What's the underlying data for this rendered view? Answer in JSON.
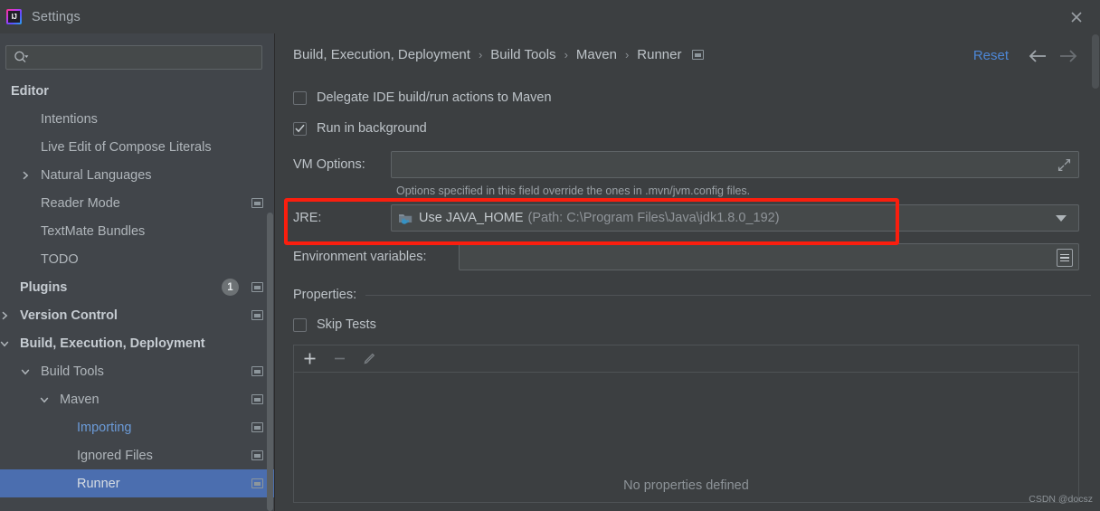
{
  "window": {
    "title": "Settings",
    "app_icon": "intellij-idea-icon",
    "close_icon": "close-icon"
  },
  "sidebar": {
    "search": {
      "placeholder": "",
      "value": "",
      "icon": "search-icon"
    },
    "items": [
      {
        "label": "Editor",
        "indent": 12,
        "bold": true,
        "arrow": "",
        "badge": "",
        "modified": false,
        "selected": false,
        "link": false
      },
      {
        "label": "Intentions",
        "indent": 45,
        "bold": false,
        "arrow": "",
        "badge": "",
        "modified": false,
        "selected": false,
        "link": false
      },
      {
        "label": "Live Edit of Compose Literals",
        "indent": 45,
        "bold": false,
        "arrow": "",
        "badge": "",
        "modified": false,
        "selected": false,
        "link": false
      },
      {
        "label": "Natural Languages",
        "indent": 45,
        "bold": false,
        "arrow": "right",
        "badge": "",
        "modified": false,
        "selected": false,
        "link": false
      },
      {
        "label": "Reader Mode",
        "indent": 45,
        "bold": false,
        "arrow": "",
        "badge": "",
        "modified": true,
        "selected": false,
        "link": false
      },
      {
        "label": "TextMate Bundles",
        "indent": 45,
        "bold": false,
        "arrow": "",
        "badge": "",
        "modified": false,
        "selected": false,
        "link": false
      },
      {
        "label": "TODO",
        "indent": 45,
        "bold": false,
        "arrow": "",
        "badge": "",
        "modified": false,
        "selected": false,
        "link": false
      },
      {
        "label": "Plugins",
        "indent": 22,
        "bold": true,
        "arrow": "",
        "badge": "1",
        "modified": true,
        "selected": false,
        "link": false
      },
      {
        "label": "Version Control",
        "indent": 22,
        "bold": true,
        "arrow": "right",
        "badge": "",
        "modified": true,
        "selected": false,
        "link": false
      },
      {
        "label": "Build, Execution, Deployment",
        "indent": 22,
        "bold": true,
        "arrow": "down",
        "badge": "",
        "modified": false,
        "selected": false,
        "link": false
      },
      {
        "label": "Build Tools",
        "indent": 45,
        "bold": false,
        "arrow": "down",
        "badge": "",
        "modified": true,
        "selected": false,
        "link": false
      },
      {
        "label": "Maven",
        "indent": 66,
        "bold": false,
        "arrow": "down",
        "badge": "",
        "modified": true,
        "selected": false,
        "link": false
      },
      {
        "label": "Importing",
        "indent": 85,
        "bold": false,
        "arrow": "",
        "badge": "",
        "modified": true,
        "selected": false,
        "link": true
      },
      {
        "label": "Ignored Files",
        "indent": 85,
        "bold": false,
        "arrow": "",
        "badge": "",
        "modified": true,
        "selected": false,
        "link": false
      },
      {
        "label": "Runner",
        "indent": 85,
        "bold": false,
        "arrow": "",
        "badge": "",
        "modified": true,
        "selected": true,
        "link": false
      }
    ]
  },
  "header": {
    "breadcrumb": [
      "Build, Execution, Deployment",
      "Build Tools",
      "Maven",
      "Runner"
    ],
    "separator": "›",
    "modified_icon": "modified-settings-icon",
    "reset_label": "Reset",
    "back_icon": "arrow-left-icon",
    "forward_icon": "arrow-right-icon"
  },
  "form": {
    "delegate": {
      "label": "Delegate IDE build/run actions to Maven",
      "checked": false
    },
    "run_background": {
      "label": "Run in background",
      "checked": true
    },
    "vm_options": {
      "label": "VM Options:",
      "value": "",
      "expand_icon": "expand-icon"
    },
    "vm_hint": "Options specified in this field override the ones in .mvn/jvm.config files.",
    "jre": {
      "label": "JRE:",
      "icon": "java-home-folder-icon",
      "value_main": "Use JAVA_HOME",
      "value_path": "(Path: C:\\Program Files\\Java\\jdk1.8.0_192)",
      "caret_icon": "chevron-down-icon"
    },
    "env_vars": {
      "label": "Environment variables:",
      "value": "",
      "browse_icon": "browse-icon"
    },
    "properties_section": "Properties:",
    "skip_tests": {
      "label": "Skip Tests",
      "checked": false
    },
    "toolbar": {
      "add_icon": "plus-icon",
      "remove_icon": "minus-icon",
      "edit_icon": "pencil-icon"
    },
    "empty_message": "No properties defined"
  },
  "watermark": "CSDN @docsz",
  "colors": {
    "background": "#3c3f41",
    "sidebar": "#41454a",
    "selection": "#4b6eaf",
    "accent_link": "#4d87d6",
    "highlight_box": "#fa1e0e",
    "text": "#bdc3c8"
  }
}
